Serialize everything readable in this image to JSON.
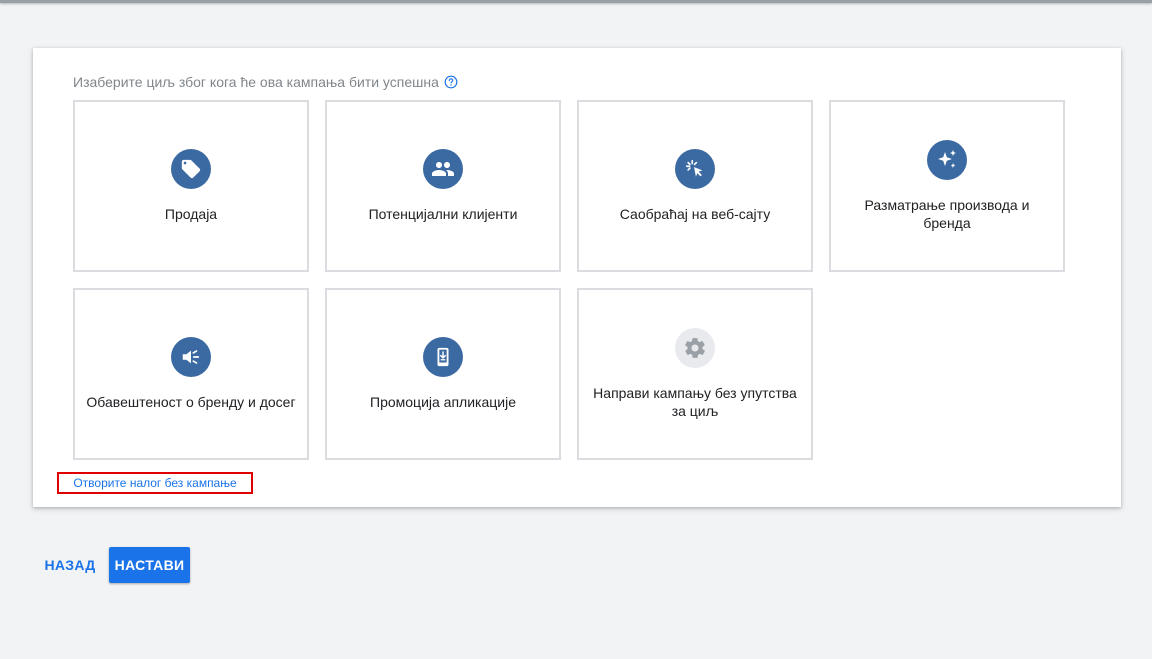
{
  "colors": {
    "icon_blue": "#3b6aa3",
    "primary_blue": "#1a73e8",
    "highlight_red": "#e00000",
    "disabled_gray": "#9aa0a6"
  },
  "prompt": {
    "text": "Изаберите циљ због кога ће ова кампања бити успешна",
    "help_icon": "help-circle-icon"
  },
  "goals": [
    {
      "label": "Продаја",
      "icon": "tag-icon"
    },
    {
      "label": "Потенцијални клијенти",
      "icon": "people-icon"
    },
    {
      "label": "Саобраћај на веб-сајту",
      "icon": "cursor-click-icon"
    },
    {
      "label": "Разматрање производа и бренда",
      "icon": "sparkle-icon"
    },
    {
      "label": "Обавештеност о бренду и досег",
      "icon": "megaphone-icon"
    },
    {
      "label": "Промоција апликације",
      "icon": "phone-download-icon"
    },
    {
      "label": "Направи кампању без упутства за циљ",
      "icon": "gear-icon"
    }
  ],
  "links": {
    "no_campaign": "Отворите налог без кампање"
  },
  "footer": {
    "back_label": "НАЗАД",
    "continue_label": "НАСТАВИ"
  }
}
